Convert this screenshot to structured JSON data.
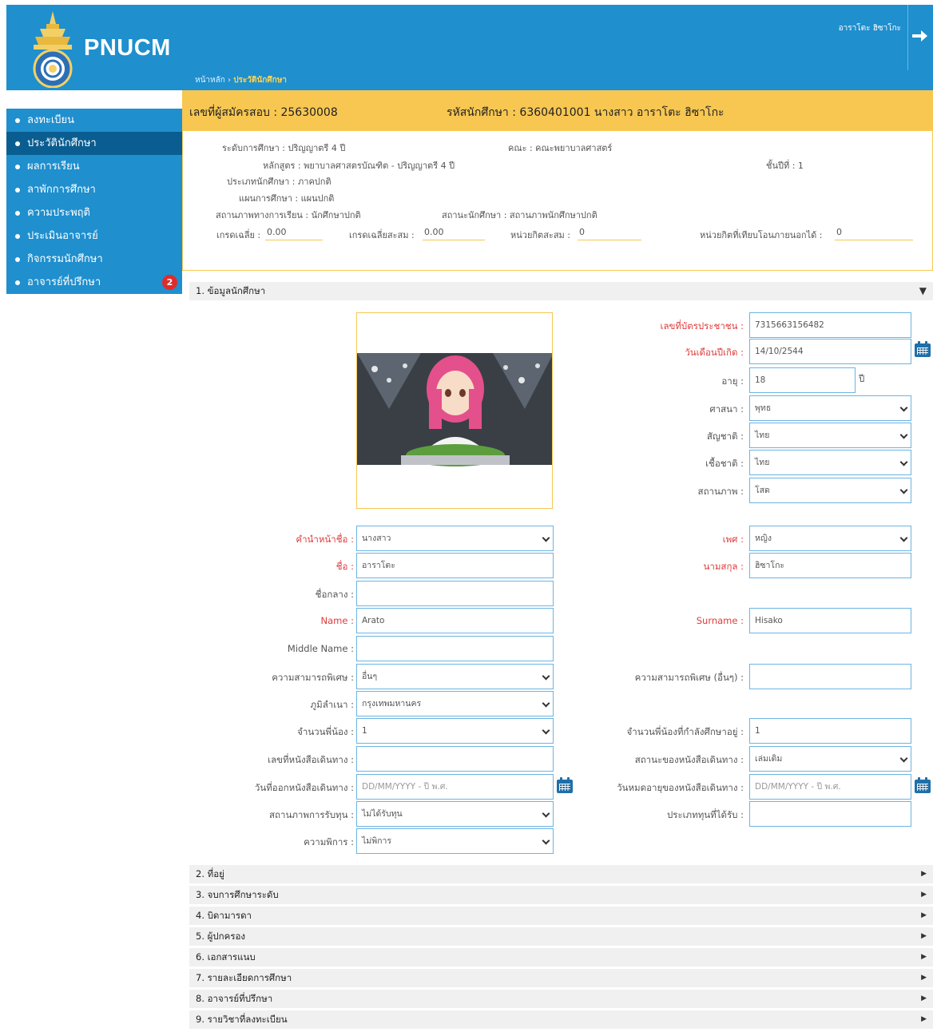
{
  "brand": {
    "name": "PNUCM"
  },
  "header": {
    "user_name": "อาราโตะ ฮิซาโกะ",
    "logout_icon": "arrow-right-icon"
  },
  "breadcrumb": {
    "home": "หน้าหลัก",
    "separator": "›",
    "current": "ประวัตินักศึกษา"
  },
  "sidebar": {
    "items": [
      {
        "label": "ลงทะเบียน",
        "active": false
      },
      {
        "label": "ประวัตินักศึกษา",
        "active": true
      },
      {
        "label": "ผลการเรียน",
        "active": false
      },
      {
        "label": "ลาพักการศึกษา",
        "active": false
      },
      {
        "label": "ความประพฤติ",
        "active": false
      },
      {
        "label": "ประเมินอาจารย์",
        "active": false
      },
      {
        "label": "กิจกรรมนักศึกษา",
        "active": false
      },
      {
        "label": "อาจารย์ที่ปรึกษา",
        "active": false,
        "badge": "2"
      }
    ]
  },
  "id_bar": {
    "applicant_no": "เลขที่ผู้สมัครสอบ : 25630008",
    "student_line": "รหัสนักศึกษา : 6360401001 นางสาว อาราโตะ ฮิซาโกะ"
  },
  "info": {
    "level": "ระดับการศึกษา : ปริญญาตรี 4 ปี",
    "faculty": "คณะ : คณะพยาบาลศาสตร์",
    "program": "หลักสูตร : พยาบาลศาสตรบัณฑิต - ปริญญาตรี 4 ปี",
    "year": "ชั้นปีที่ : 1",
    "student_type": "ประเภทนักศึกษา : ภาคปกติ",
    "plan": "แผนการศึกษา : แผนปกติ",
    "academic_status": "สถานภาพทางการเรียน : นักศึกษาปกติ",
    "student_status": "สถานะนักศึกษา : สถานภาพนักศึกษาปกติ",
    "gpa_label": "เกรดเฉลี่ย :",
    "gpa": "0.00",
    "gpax_label": "เกรดเฉลี่ยสะสม :",
    "gpax": "0.00",
    "credits_label": "หน่วยกิตสะสม :",
    "credits": "0",
    "transfer_label": "หน่วยกิตที่เทียบโอนภายนอกได้ :",
    "transfer": "0"
  },
  "sections": [
    "1. ข้อมูลนักศึกษา",
    "2. ที่อยู่",
    "3. จบการศึกษาระดับ",
    "4. บิดามารดา",
    "5. ผู้ปกครอง",
    "6. เอกสารแนบ",
    "7. รายละเอียดการศึกษา",
    "8. อาจารย์ที่ปรึกษา",
    "9. รายวิชาที่ลงทะเบียน"
  ],
  "form": {
    "id_card": {
      "label": "เลขที่บัตรประชาชน :",
      "value": "7315663156482"
    },
    "birthdate": {
      "label": "วันเดือนปีเกิด :",
      "value": "14/10/2544"
    },
    "age": {
      "label": "อายุ :",
      "value": "18",
      "unit": "ปี"
    },
    "religion": {
      "label": "ศาสนา :",
      "value": "พุทธ"
    },
    "nationality": {
      "label": "สัญชาติ :",
      "value": "ไทย"
    },
    "race": {
      "label": "เชื้อชาติ :",
      "value": "ไทย"
    },
    "marital": {
      "label": "สถานภาพ :",
      "value": "โสด"
    },
    "prefix": {
      "label": "คำนำหน้าชื่อ :",
      "value": "นางสาว"
    },
    "gender": {
      "label": "เพศ :",
      "value": "หญิง"
    },
    "first_name": {
      "label": "ชื่อ :",
      "value": "อาราโตะ"
    },
    "last_name": {
      "label": "นามสกุล :",
      "value": "ฮิซาโกะ"
    },
    "middle_name": {
      "label": "ชื่อกลาง :",
      "value": ""
    },
    "name_en": {
      "label": "Name :",
      "value": "Arato"
    },
    "surname_en": {
      "label": "Surname :",
      "value": "Hisako"
    },
    "middle_name_en": {
      "label": "Middle Name :",
      "value": ""
    },
    "ability": {
      "label": "ความสามารถพิเศษ :",
      "value": "อื่นๆ"
    },
    "ability_other": {
      "label": "ความสามารถพิเศษ (อื่นๆ) :",
      "value": ""
    },
    "hometown": {
      "label": "ภูมิลำเนา :",
      "value": "กรุงเทพมหานคร"
    },
    "siblings": {
      "label": "จำนวนพี่น้อง :",
      "value": "1"
    },
    "siblings_studying": {
      "label": "จำนวนพี่น้องที่กำลังศึกษาอยู่ :",
      "value": "1"
    },
    "passport_no": {
      "label": "เลขที่หนังสือเดินทาง :",
      "value": ""
    },
    "passport_status": {
      "label": "สถานะของหนังสือเดินทาง :",
      "value": "เล่มเดิม"
    },
    "passport_issue": {
      "label": "วันที่ออกหนังสือเดินทาง :",
      "placeholder": "DD/MM/YYYY - ปี พ.ศ."
    },
    "passport_expire": {
      "label": "วันหมดอายุของหนังสือเดินทาง :",
      "placeholder": "DD/MM/YYYY - ปี พ.ศ."
    },
    "scholarship_status": {
      "label": "สถานภาพการรับทุน :",
      "value": "ไม่ได้รับทุน"
    },
    "scholarship_type": {
      "label": "ประเภททุนที่ได้รับ :",
      "value": ""
    },
    "disability": {
      "label": "ความพิการ :",
      "value": "ไม่พิการ"
    }
  },
  "colors": {
    "primary": "#1f8fce",
    "active": "#0a5d91",
    "accent": "#f7c752",
    "required": "#e03b3b"
  }
}
